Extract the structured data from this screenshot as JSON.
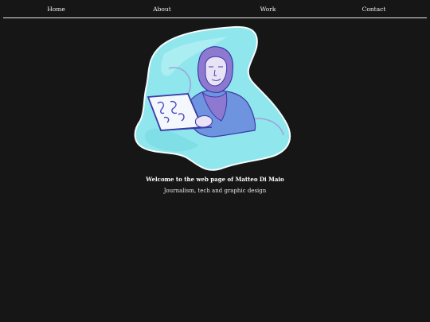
{
  "nav": {
    "items": [
      {
        "label": "Home"
      },
      {
        "label": "About"
      },
      {
        "label": "Work"
      },
      {
        "label": "Contact"
      }
    ]
  },
  "hero": {
    "title": "Welcome to the web page of Matteo Di Maio",
    "subtitle": "Journalism, tech and graphic design",
    "illustration_icon": "person-at-laptop-illustration"
  },
  "colors": {
    "background": "#161616",
    "splash": "#8fe6ec",
    "figure": "#8d7ad0",
    "outline": "#3b3aa8"
  }
}
